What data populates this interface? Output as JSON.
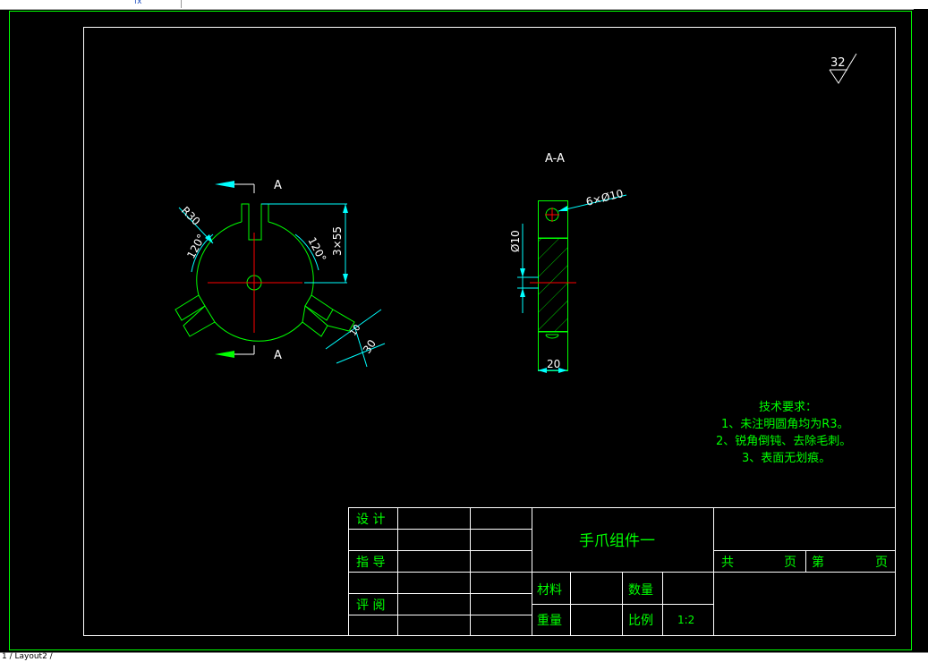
{
  "toolbar": {
    "fx_symbol": "fx",
    "layout_tab": "1 / Layout2 /"
  },
  "colors": {
    "frame": "#00ff00",
    "dimension": "#00ffff",
    "centerline": "#ff0000",
    "title_text": "#00ff00"
  },
  "drawing": {
    "roughness_value": "32",
    "section_label": "A-A",
    "cut_label_top": "A",
    "cut_label_bottom": "A",
    "dim_r30": "R30",
    "dim_angle_left": "120°",
    "dim_angle_right": "120°",
    "dim_3x55": "3×55",
    "dim_30": "30",
    "dim_10_small": "10",
    "dim_holes": "6×Ø10",
    "dim_dia10": "Ø10",
    "dim_20": "20"
  },
  "notes": {
    "heading": "技术要求：",
    "items": [
      "1、未注明圆角均为R3。",
      "2、锐角倒钝、去除毛刺。",
      "3、表面无划痕。"
    ]
  },
  "title_block": {
    "design_label": "设 计",
    "guide_label": "指 导",
    "review_label": "评 阅",
    "part_name": "手爪组件一",
    "total_label": "共",
    "page_label": "页",
    "nth_label": "第",
    "page_label2": "页",
    "material_label": "材料",
    "quantity_label": "数量",
    "weight_label": "重量",
    "scale_label": "比例",
    "scale_value": "1:2"
  }
}
